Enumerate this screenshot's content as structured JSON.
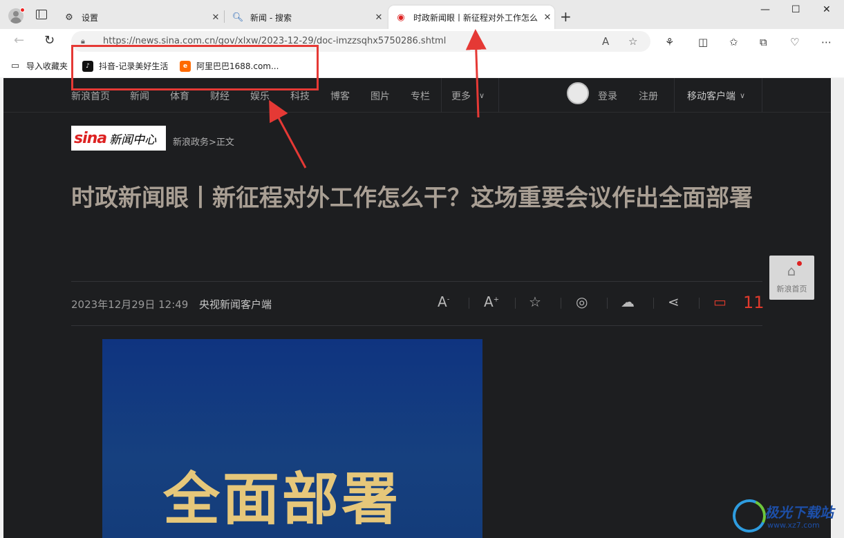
{
  "tabs": [
    {
      "label": "设置",
      "icon": "gear-icon"
    },
    {
      "label": "新闻 - 搜索",
      "icon": "search-icon"
    },
    {
      "label": "时政新闻眼丨新征程对外工作怎么",
      "icon": "weibo-icon",
      "active": true
    }
  ],
  "address": {
    "url": "https://news.sina.com.cn/gov/xlxw/2023-12-29/doc-imzzsqhx5750286.shtml"
  },
  "favorites": {
    "import_label": "导入收藏夹",
    "items": [
      {
        "label": "抖音-记录美好生活",
        "icon": "tiktok-icon",
        "color": "#111111"
      },
      {
        "label": "阿里巴巴1688.com...",
        "icon": "alibaba-icon",
        "color": "#ff6a00"
      }
    ]
  },
  "site_nav": {
    "items": [
      "新浪首页",
      "新闻",
      "体育",
      "财经",
      "娱乐",
      "科技",
      "博客",
      "图片",
      "专栏",
      "更多"
    ],
    "login": "登录",
    "register": "注册",
    "mobile": "移动客户端"
  },
  "logo": {
    "brand": "sina",
    "section": "新闻中心"
  },
  "breadcrumb": "新浪政务>正文",
  "article": {
    "title": "时政新闻眼丨新征程对外工作怎么干？这场重要会议作出全面部署",
    "date": "2023年12月29日 12:49",
    "source": "央视新闻客户端",
    "comment_count": "11",
    "poster_text": "全面部署"
  },
  "float_home": {
    "label": "新浪首页"
  },
  "watermark": {
    "title": "极光下载站",
    "url": "www.xz7.com"
  },
  "colors": {
    "annotation": "#e53935",
    "page_bg": "#1d1e20",
    "comment": "#e03a2c"
  }
}
